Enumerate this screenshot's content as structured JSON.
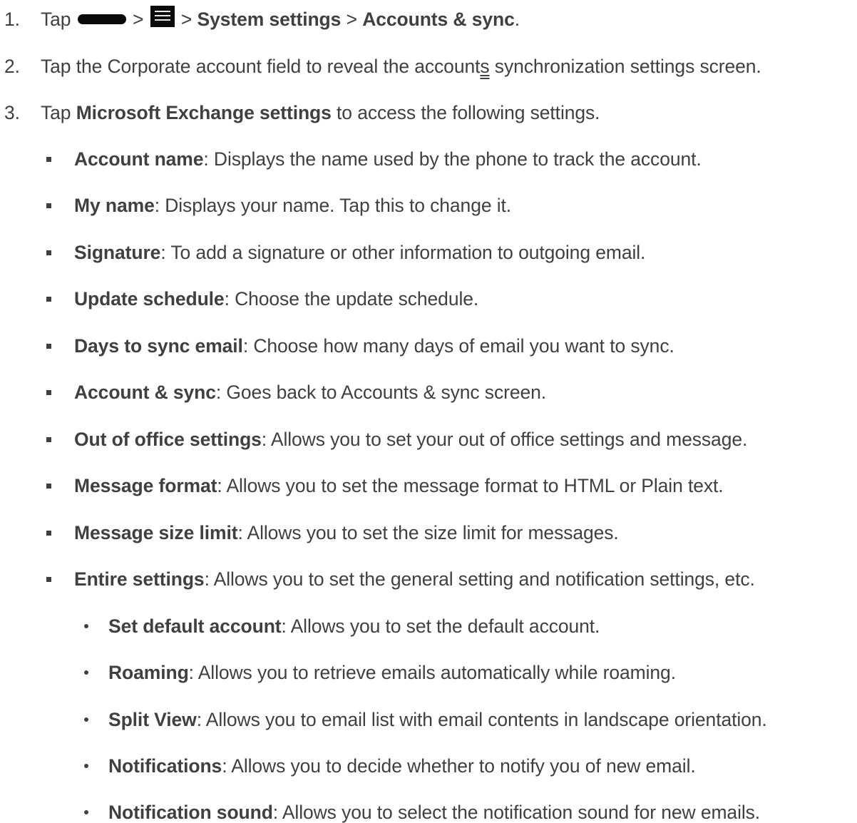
{
  "steps": [
    {
      "number": "1.",
      "tap": "Tap",
      "sep1": ">",
      "sep2": ">",
      "system_settings": "System settings",
      "sep3": ">",
      "accounts_sync": "Accounts & sync",
      "end": ".",
      "icons": [
        "home-key-icon",
        "menu-key-icon"
      ]
    },
    {
      "number": "2.",
      "text_before": "Tap the Corporate account field to reveal the account",
      "underlined": "s",
      "text_after": "synchronization settings screen."
    },
    {
      "number": "3.",
      "tap": "Tap",
      "bold": "Microsoft Exchange settings",
      "rest": "to access the following settings."
    }
  ],
  "settings": [
    {
      "term": "Account name",
      "desc": ": Displays the name used by the phone to track the account."
    },
    {
      "term": "My name",
      "desc": ": Displays your name. Tap this to change it."
    },
    {
      "term": "Signature",
      "desc": ": To add a signature or other information to outgoing email."
    },
    {
      "term": "Update schedule",
      "desc": ": Choose the update schedule."
    },
    {
      "term": "Days to sync email",
      "desc": ": Choose how many days of email you want to sync."
    },
    {
      "term": "Account & sync",
      "desc": ": Goes back to Accounts & sync screen."
    },
    {
      "term": "Out of office settings",
      "desc": ": Allows you to set your out of office settings and message."
    },
    {
      "term": "Message format",
      "desc": ": Allows you to set the message format to HTML or Plain text."
    },
    {
      "term": "Message size limit",
      "desc": ": Allows you to set the size limit for messages."
    },
    {
      "term": "Entire settings",
      "desc": ": Allows you to set the general setting and notification settings, etc."
    }
  ],
  "entire_settings_sub": [
    {
      "term": "Set default account",
      "desc": ": Allows you to set the default account."
    },
    {
      "term": "Roaming",
      "desc": ": Allows you to retrieve emails automatically while roaming."
    },
    {
      "term": "Split View",
      "desc": ": Allows you to email list with email contents in landscape orientation."
    },
    {
      "term": "Notifications",
      "desc": ": Allows you to decide whether to notify you of new email."
    },
    {
      "term": "Notification sound",
      "desc": ": Allows you to select the notification sound for new emails."
    }
  ]
}
